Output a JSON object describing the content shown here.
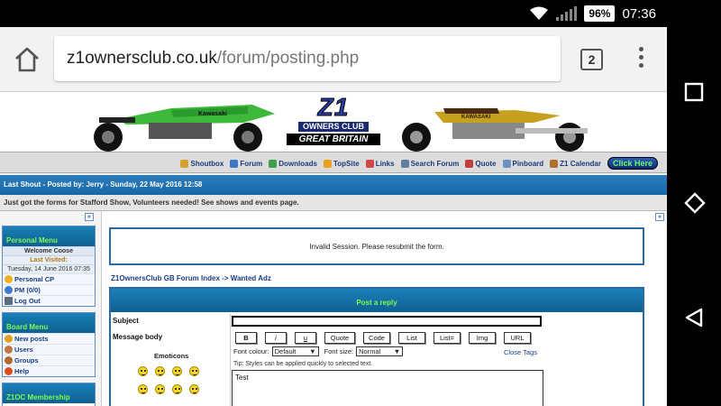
{
  "status": {
    "battery": "96%",
    "time": "07:36"
  },
  "browser": {
    "url_host": "z1ownersclub.co.uk",
    "url_path": "/forum/posting.php",
    "tab_count": "2"
  },
  "banner": {
    "logo_main": "Z1",
    "logo_owners": "OWNERS CLUB",
    "logo_gb": "GREAT BRITAIN",
    "left_bike_brand": "Kawasaki",
    "right_bike_brand": "KAWASAKI"
  },
  "nav": {
    "items": [
      "Shoutbox",
      "Forum",
      "Downloads",
      "TopSite",
      "Links",
      "Search Forum",
      "Quote",
      "Pinboard",
      "Z1 Calendar"
    ],
    "icon_colors": [
      "#d9a030",
      "#3a78c8",
      "#3aa04a",
      "#e8a020",
      "#d04848",
      "#6080a0",
      "#c04040",
      "#7090c0",
      "#b07030"
    ],
    "cta": "Click Here"
  },
  "shout": {
    "header": "Last Shout - Posted by: Jerry - Sunday, 22 May 2016 12:58",
    "message": "Just got the forms for Stafford Show, Volunteers needed! See shows and events page."
  },
  "sidebar": {
    "collapse_glyph": "«",
    "personal": {
      "title": "Personal Menu",
      "welcome": "Welcome Coose",
      "last_visited_label": "Last Visited:",
      "last_visited": "Tuesday, 14 June 2016 07:35",
      "links": [
        "Personal CP",
        "PM (0/0)",
        "Log Out"
      ]
    },
    "board": {
      "title": "Board Menu",
      "links": [
        "New posts",
        "Users",
        "Groups",
        "Help"
      ]
    },
    "membership": {
      "title": "Z1OC Membership"
    }
  },
  "main": {
    "collapse_glyph": "«",
    "invalid_message": "Invalid Session. Please resubmit the form.",
    "breadcrumb_root": "Z1OwnersClub GB Forum Index",
    "breadcrumb_sep": "->",
    "breadcrumb_leaf": "Wanted Adz",
    "form_title": "Post a reply",
    "subject_label": "Subject",
    "message_label": "Message body",
    "emoticons_label": "Emoticons",
    "toolbar": [
      "B",
      "i",
      "u",
      "Quote",
      "Code",
      "List",
      "List=",
      "Img",
      "URL"
    ],
    "font_colour_label": "Font colour:",
    "font_colour_value": "Default",
    "font_size_label": "Font size:",
    "font_size_value": "Normal",
    "close_tags": "Close Tags",
    "tip": "Tip: Styles can be applied quickly to selected text.",
    "message_value": "Test"
  }
}
